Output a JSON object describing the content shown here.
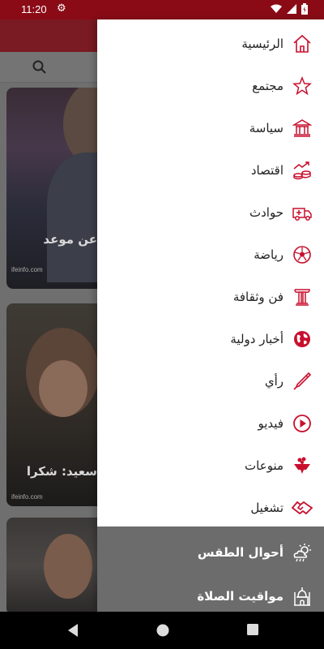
{
  "status_bar": {
    "time": "11:20",
    "icons": [
      "gear-icon",
      "wifi-icon",
      "signal-icon",
      "battery-icon"
    ]
  },
  "background": {
    "cards": [
      {
        "headline": "عن موعد",
        "source": "ifeinfo.com"
      },
      {
        "headline": "سعيد: شكرا",
        "source": "ifeinfo.com"
      },
      {
        "headline": "",
        "source": ""
      }
    ]
  },
  "drawer": {
    "accent_color": "#c8102e",
    "items": [
      {
        "label": "الرئيسية",
        "icon": "home-icon"
      },
      {
        "label": "مجتمع",
        "icon": "star-icon"
      },
      {
        "label": "سياسة",
        "icon": "government-building-icon"
      },
      {
        "label": "اقتصاد",
        "icon": "coins-chart-icon"
      },
      {
        "label": "حوادث",
        "icon": "ambulance-icon"
      },
      {
        "label": "رياضة",
        "icon": "soccer-ball-icon"
      },
      {
        "label": "فن وثقافة",
        "icon": "column-icon"
      },
      {
        "label": "أخبار دولية",
        "icon": "globe-icon"
      },
      {
        "label": "رأي",
        "icon": "pen-icon"
      },
      {
        "label": "فيديو",
        "icon": "play-icon"
      },
      {
        "label": "منوعات",
        "icon": "bowl-icon"
      },
      {
        "label": "تشغيل",
        "icon": "handshake-icon"
      }
    ],
    "secondary_items": [
      {
        "label": "أحوال الطقس",
        "icon": "weather-icon"
      },
      {
        "label": "مواقيت الصلاة",
        "icon": "mosque-icon"
      }
    ]
  },
  "nav_bar": {
    "buttons": [
      "back-icon",
      "home-circle-icon",
      "recents-icon"
    ]
  }
}
